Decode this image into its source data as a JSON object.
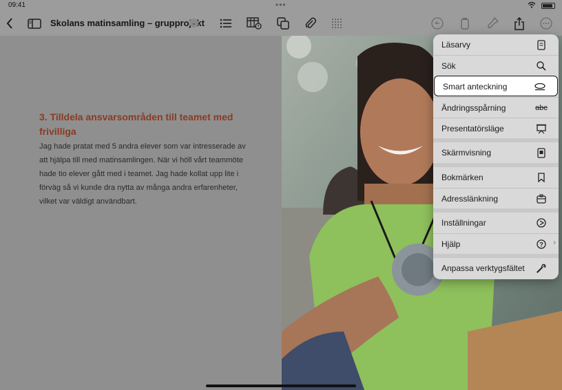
{
  "status": {
    "time": "09:41"
  },
  "document": {
    "title": "Skolans matinsamling – grupprojekt",
    "heading": "3. Tilldela ansvarsområden till teamet med frivilliga",
    "body": "Jag hade pratat med 5 andra elever som var intresserade av att hjälpa till med matinsamlingen. När vi höll vårt teammöte hade tio elever gått med i teamet. Jag hade kollat upp lite i förväg så vi kunde dra nytta av många andra erfarenheter, vilket var väldigt användbart."
  },
  "menu": {
    "items": [
      {
        "label": "Läsarvy",
        "icon": "reader-view-icon"
      },
      {
        "label": "Sök",
        "icon": "search-icon"
      },
      {
        "label": "Smart anteckning",
        "icon": "smart-annotation-icon",
        "selected": true
      },
      {
        "label": "Ändringsspårning",
        "icon": "strikethrough-abc-icon",
        "icon_text": "abc"
      },
      {
        "label": "Presentatörsläge",
        "icon": "presenter-icon"
      },
      {
        "label": "Skärmvisning",
        "icon": "screen-view-icon"
      },
      {
        "label": "Bokmärken",
        "icon": "bookmark-icon"
      },
      {
        "label": "Adresslänkning",
        "icon": "link-address-icon"
      },
      {
        "label": "Inställningar",
        "icon": "settings-icon"
      },
      {
        "label": "Hjälp",
        "icon": "help-icon"
      },
      {
        "label": "Anpassa verktygsfältet",
        "icon": "wrench-icon"
      }
    ]
  }
}
